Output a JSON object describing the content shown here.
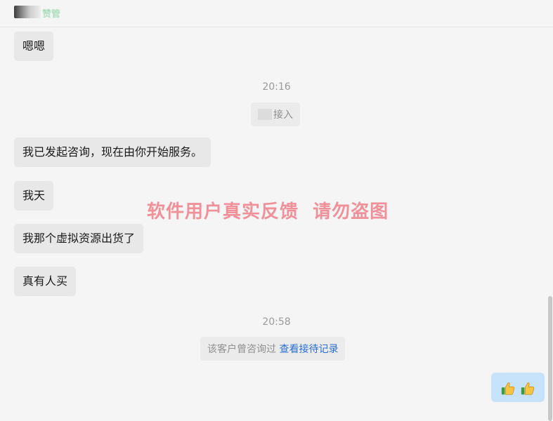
{
  "header": {
    "contact_name": "赞管"
  },
  "messages": [
    {
      "text": "嗯嗯"
    },
    {
      "text": "我已发起咨询，现在由你开始服务。"
    },
    {
      "text": "我天"
    },
    {
      "text": "我那个虚拟资源出货了"
    },
    {
      "text": "真有人买"
    }
  ],
  "timestamps": {
    "first": "20:16",
    "second": "20:58"
  },
  "system": {
    "joined_text": "接入",
    "consult_prefix": "该客户曾咨询过",
    "consult_link": "查看接待记录"
  },
  "outgoing": {
    "emoji": "thumbs-up x2"
  },
  "watermark": {
    "text": "软件用户真实反馈  请勿盗图"
  },
  "colors": {
    "incoming_bubble": "#e8e8e8",
    "outgoing_bubble": "#c6e3fb",
    "link": "#2a6fd6",
    "watermark": "#eb3c4b"
  }
}
